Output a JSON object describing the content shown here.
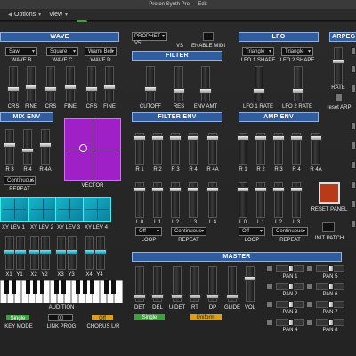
{
  "window": {
    "title": "Proton Synth Pro — Edit"
  },
  "menu": {
    "options": "Options",
    "view": "View"
  },
  "wave": {
    "title": "WAVE",
    "selects": [
      "Saw",
      "Square",
      "Warm Bell"
    ],
    "sel_labels": [
      "WAVE B",
      "WAVE C",
      "WAVE D"
    ],
    "fader_labels": [
      "CRS",
      "FINE",
      "CRS",
      "FINE",
      "CRS",
      "FINE"
    ]
  },
  "preset": {
    "name": "PROPHET V5",
    "vs": "VS",
    "enable_midi": "ENABLE MIDI"
  },
  "lfo": {
    "title": "LFO",
    "selects": [
      "Triangle",
      "Triangle"
    ],
    "sel_labels": [
      "LFO 1 SHAPE",
      "LFO 2 SHAPE"
    ],
    "fader_labels": [
      "LFO 1 RATE",
      "LFO 2 RATE"
    ]
  },
  "arp": {
    "title": "ARPEG",
    "rate": "RATE",
    "reset": "reset ARP"
  },
  "filter": {
    "title": "FILTER",
    "fader_labels": [
      "CUTOFF",
      "RES",
      "ENV AMT"
    ]
  },
  "mix_env": {
    "title": "MIX ENV",
    "fader_labels": [
      "R 3",
      "R 4",
      "R 4A"
    ],
    "repeat_value": "Continuous",
    "repeat_label": "REPEAT"
  },
  "vector": {
    "label": "VECTOR"
  },
  "filter_env": {
    "title": "FILTER ENV",
    "top_labels": [
      "R 1",
      "R 2",
      "R 3",
      "R 4",
      "R 4A"
    ],
    "bottom_labels": [
      "L 0",
      "L 1",
      "L 2",
      "L 3",
      "L 4"
    ],
    "loop_value": "Off",
    "loop_label": "LOOP",
    "repeat_value": "Continuous",
    "repeat_label": "REPEAT"
  },
  "amp_env": {
    "title": "AMP ENV",
    "top_labels": [
      "R 1",
      "R 2",
      "R 3",
      "R 4",
      "R 4A"
    ],
    "bottom_labels": [
      "L 0",
      "L 1",
      "L 2",
      "L 3"
    ],
    "loop_value": "Off",
    "loop_label": "LOOP",
    "repeat_value": "Continuous",
    "repeat_label": "REPEAT"
  },
  "reset_panel": {
    "label": "RESET PANEL"
  },
  "init_patch": {
    "label": "INIT PATCH"
  },
  "xy": {
    "labels": [
      "XY LEV 1",
      "XY LEV 2",
      "XY LEV 3",
      "XY LEV 4"
    ],
    "fader_labels": [
      "X1",
      "Y1",
      "X2",
      "Y2",
      "X3",
      "Y3",
      "X4",
      "Y4"
    ]
  },
  "audition": {
    "label": "AUDITION"
  },
  "bottom": {
    "key_mode_value": "Single",
    "key_mode_label": "KEY MODE",
    "link_prog_value": "00",
    "link_prog_label": "LINK PROG",
    "chorus_value": "Off",
    "chorus_label": "CHORUS L/R"
  },
  "master": {
    "title": "MASTER",
    "fader_labels": [
      "DET",
      "DEL",
      "U-DET",
      "RT",
      "DP",
      "GLIDE",
      "VOL"
    ],
    "det_value": "Single",
    "dp_value": "Uniform"
  },
  "pan": {
    "labels": [
      "PAN 1",
      "PAN 5",
      "PAN 2",
      "PAN 6",
      "PAN 3",
      "PAN 7",
      "PAN 4",
      "PAN 8"
    ]
  },
  "colors": {
    "panel_bg": "#232323",
    "title_blue": "#2f5d9f",
    "teal": "#16b5c9",
    "purple": "#a020c8",
    "green": "#3fa03f",
    "gold": "#d8a01c",
    "red": "#b83a18"
  }
}
